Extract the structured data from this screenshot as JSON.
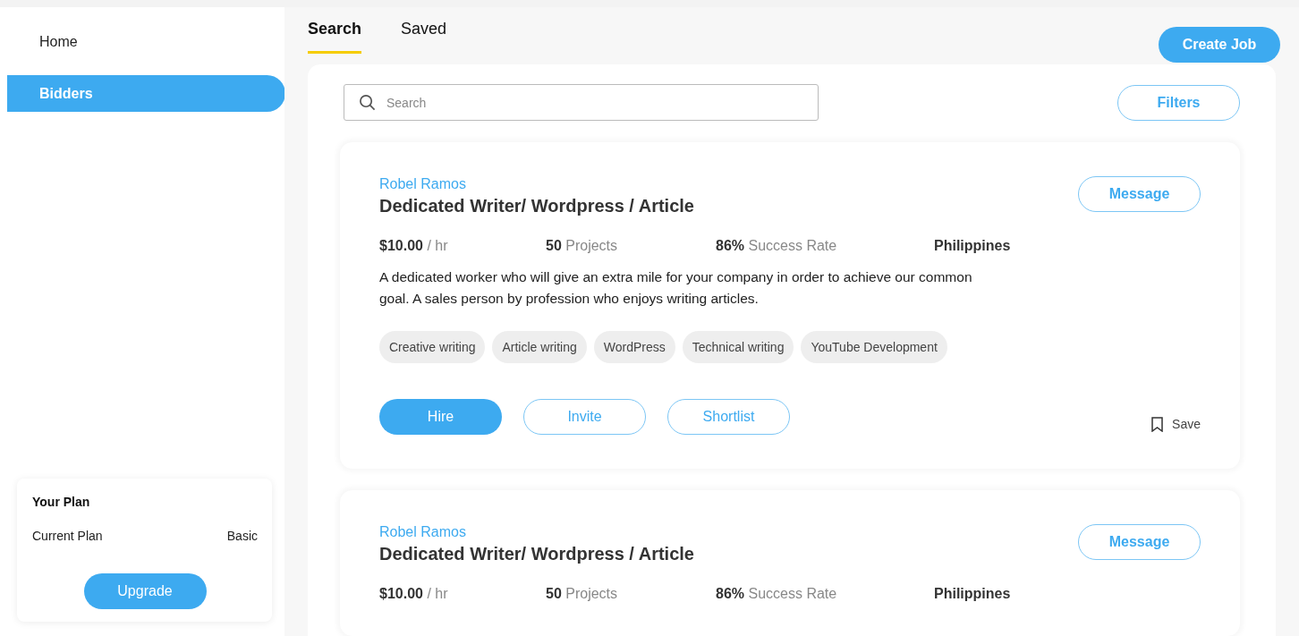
{
  "sidebar": {
    "items": [
      {
        "label": "Home",
        "selected": false
      },
      {
        "label": "Bidders",
        "selected": true
      }
    ],
    "plan": {
      "title": "Your Plan",
      "label": "Current Plan",
      "value": "Basic",
      "button": "Upgrade"
    }
  },
  "tabs": [
    {
      "label": "Search",
      "selected": true
    },
    {
      "label": "Saved",
      "selected": false
    }
  ],
  "create_button": "Create Job",
  "search": {
    "placeholder": "Search"
  },
  "filters_button": "Filters",
  "cards": [
    {
      "name": "Robel Ramos",
      "title": "Dedicated Writer/ Wordpress / Article",
      "message_button": "Message",
      "stats": [
        {
          "value": "$10.00",
          "unit": "/ hr"
        },
        {
          "value": "50",
          "unit": "Projects"
        },
        {
          "value": "86%",
          "unit": "Success Rate"
        },
        {
          "value": "Philippines"
        }
      ],
      "description": "A dedicated worker who will give an extra mile for your company in order to achieve our common goal. A sales person by profession who enjoys writing articles.",
      "tags": [
        "Creative writing",
        "Article writing",
        "WordPress",
        "Technical writing",
        "YouTube Development"
      ],
      "actions": [
        {
          "label": "Hire",
          "kind": "primary"
        },
        {
          "label": "Invite",
          "kind": "outline"
        },
        {
          "label": "Shortlist",
          "kind": "outline"
        }
      ],
      "save": "Save"
    },
    {
      "name": "Robel Ramos",
      "title": "Dedicated Writer/ Wordpress / Article",
      "message_button": "Message",
      "stats": [
        {
          "value": "$10.00",
          "unit": "/ hr"
        },
        {
          "value": "50",
          "unit": "Projects"
        },
        {
          "value": "86%",
          "unit": "Success Rate"
        },
        {
          "value": "Philippines"
        }
      ]
    }
  ]
}
